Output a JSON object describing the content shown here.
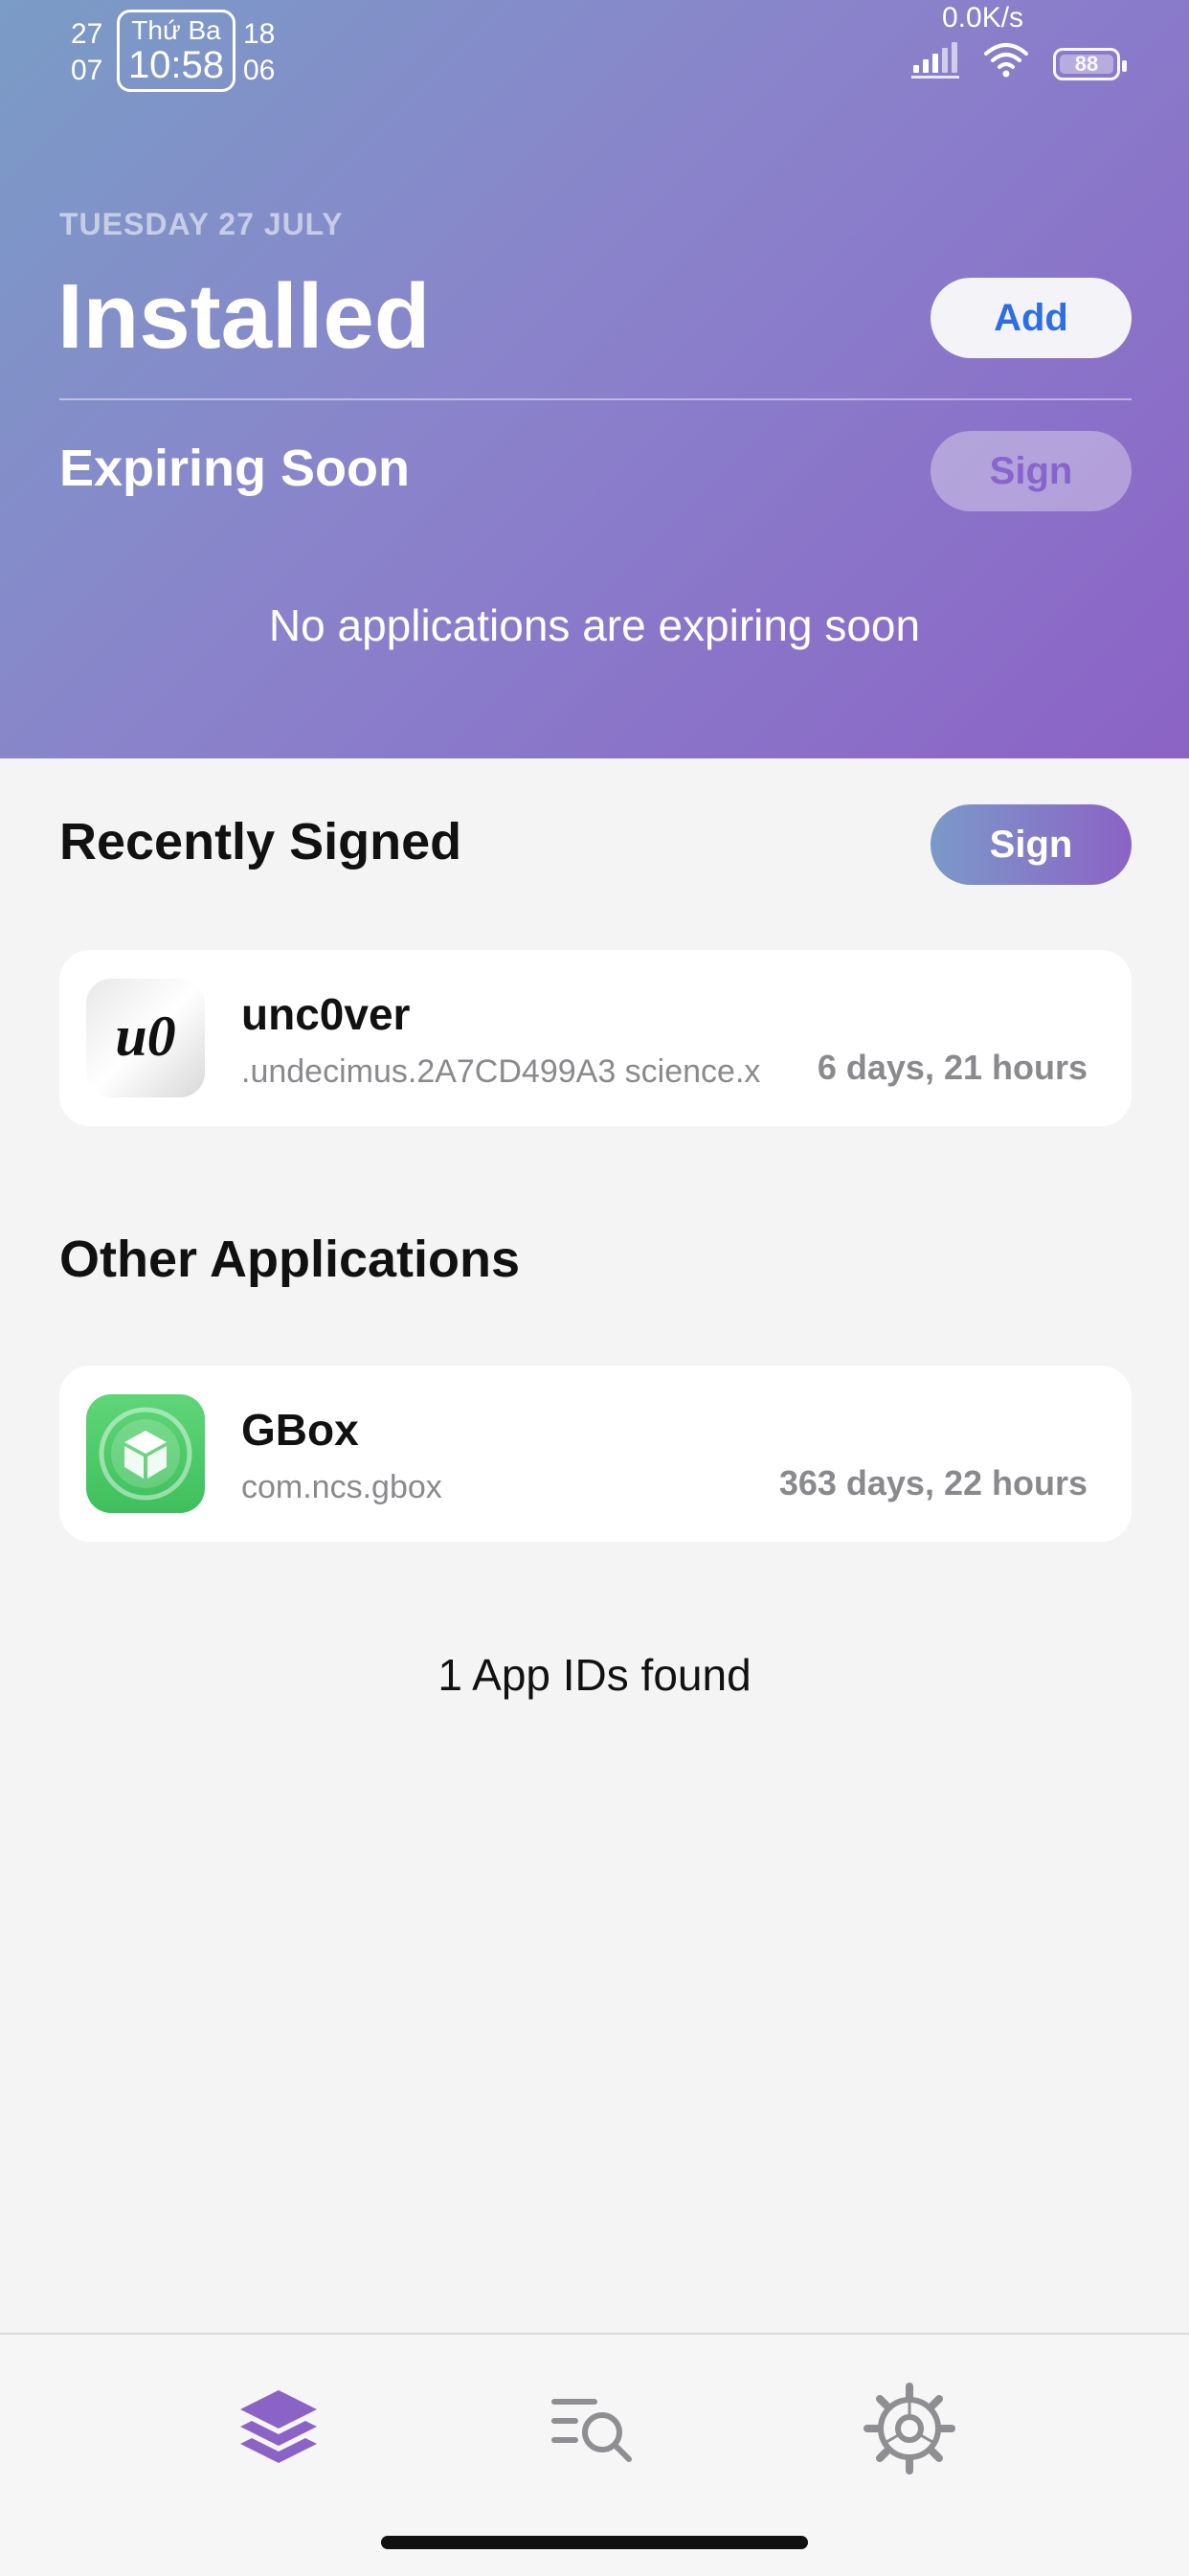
{
  "status_bar": {
    "left_date_top": "27",
    "left_date_bottom": "07",
    "day_of_week": "Thứ Ba",
    "time": "10:58",
    "right_date_top": "18",
    "right_date_bottom": "06",
    "net_speed": "0.0K/s",
    "battery": "88"
  },
  "header": {
    "date": "TUESDAY 27 JULY",
    "title": "Installed",
    "add_label": "Add",
    "expiring_title": "Expiring Soon",
    "expiring_sign_label": "Sign",
    "no_expiring": "No applications are expiring soon"
  },
  "recently_signed": {
    "title": "Recently Signed",
    "sign_label": "Sign",
    "apps": [
      {
        "name": "unc0ver",
        "bundle": ".undecimus.2A7CD499A3    science.x",
        "expiry": "6 days, 21 hours",
        "icon_text": "u0"
      }
    ]
  },
  "other_applications": {
    "title": "Other Applications",
    "apps": [
      {
        "name": "GBox",
        "bundle": "com.ncs.gbox",
        "expiry": "363 days, 22 hours"
      }
    ]
  },
  "footer_text": "1 App IDs found",
  "tabs": [
    {
      "icon": "apps-stack-icon",
      "active": true
    },
    {
      "icon": "search-list-icon",
      "active": false
    },
    {
      "icon": "settings-gear-icon",
      "active": false
    }
  ],
  "colors": {
    "accent": "#8b63c6",
    "link_blue": "#2d6ee6",
    "header_gradient_start": "#7a9cc6",
    "header_gradient_end": "#8b63c6"
  }
}
